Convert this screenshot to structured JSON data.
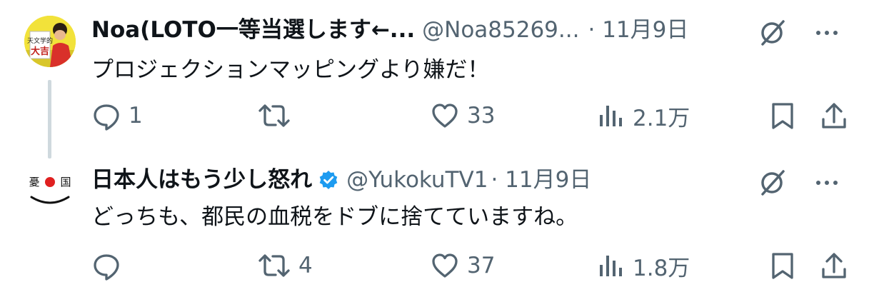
{
  "tweets": [
    {
      "display_name": "Noa(LOTO一等当選します←...",
      "handle": "@Noa85269...",
      "date": "· 11月9日",
      "text": "プロジェクションマッピングより嫌だ！",
      "avatar_text": "天文学的 大吉",
      "actions": {
        "reply": "1",
        "retweet": "",
        "like": "33",
        "views": "2.1万"
      }
    },
    {
      "display_name": "日本人はもう少し怒れ",
      "handle": "@YukokuTV1",
      "date": "· 11月9日",
      "text": "どっちも、都民の血税をドブに捨てていますね。",
      "avatar_text": "憂国",
      "actions": {
        "reply": "",
        "retweet": "4",
        "like": "37",
        "views": "1.8万"
      }
    }
  ],
  "colors": {
    "text_primary": "#0f1419",
    "text_secondary": "#536471",
    "verified_blue": "#1d9bf0",
    "thread_line": "#cfd9de"
  },
  "icons": [
    "grok-icon",
    "more-icon",
    "reply-icon",
    "retweet-icon",
    "like-icon",
    "views-icon",
    "bookmark-icon",
    "share-icon",
    "verified-icon"
  ]
}
